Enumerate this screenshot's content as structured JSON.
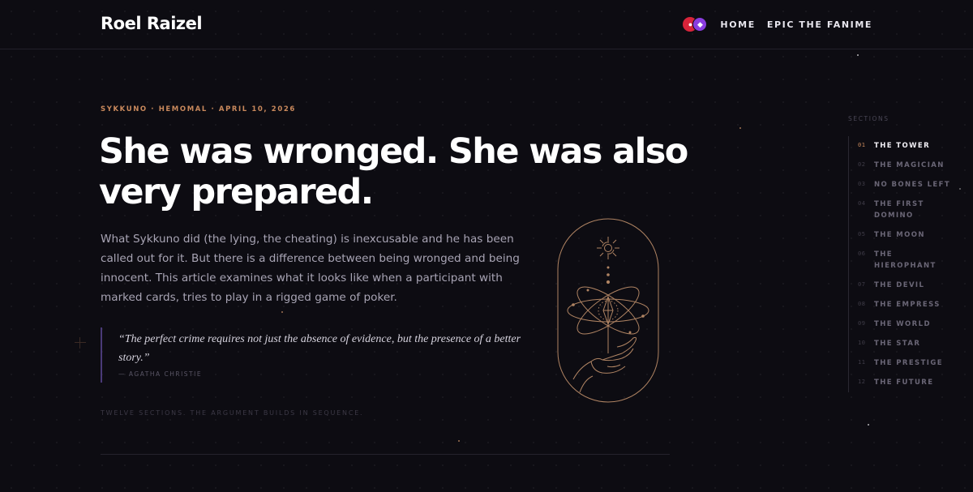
{
  "header": {
    "brand": "Roel Raizel",
    "avatars": [
      "avatar-red",
      "avatar-purple"
    ],
    "nav": [
      {
        "label": "HOME"
      },
      {
        "label": "EPIC THE FANIME"
      }
    ]
  },
  "article": {
    "meta": "SYKKUNO · HEMOMAL · APRIL 10, 2026",
    "title": "She was wronged. She was also very prepared.",
    "lede": "What Sykkuno did (the lying, the cheating) is inexcusable and he has been called out for it. But there is a difference between being wronged and being innocent. This article examines what it looks like when a participant with marked cards, tries to play in a rigged game of poker.",
    "quote": {
      "text": "“The perfect crime requires not just the absence of evidence, but the presence of a better story.”",
      "attribution": "— AGATHA CHRISTIE"
    },
    "note": "TWELVE SECTIONS. THE ARGUMENT BUILDS IN SEQUENCE."
  },
  "illustration": {
    "icon": "tarot-hand-atom-illustration",
    "stroke_color": "#b08463"
  },
  "sections": {
    "title": "SECTIONS",
    "items": [
      {
        "num": "01",
        "label": "THE TOWER",
        "active": true
      },
      {
        "num": "02",
        "label": "THE MAGICIAN"
      },
      {
        "num": "03",
        "label": "NO BONES LEFT"
      },
      {
        "num": "04",
        "label": "THE FIRST DOMINO"
      },
      {
        "num": "05",
        "label": "THE MOON"
      },
      {
        "num": "06",
        "label": "THE HIEROPHANT"
      },
      {
        "num": "07",
        "label": "THE DEVIL"
      },
      {
        "num": "08",
        "label": "THE EMPRESS"
      },
      {
        "num": "09",
        "label": "THE WORLD"
      },
      {
        "num": "10",
        "label": "THE STAR"
      },
      {
        "num": "11",
        "label": "THE PRESTIGE"
      },
      {
        "num": "12",
        "label": "THE FUTURE"
      }
    ]
  },
  "colors": {
    "background": "#0d0c12",
    "accent": "#c9895c",
    "quote_border": "#4a3a78"
  }
}
